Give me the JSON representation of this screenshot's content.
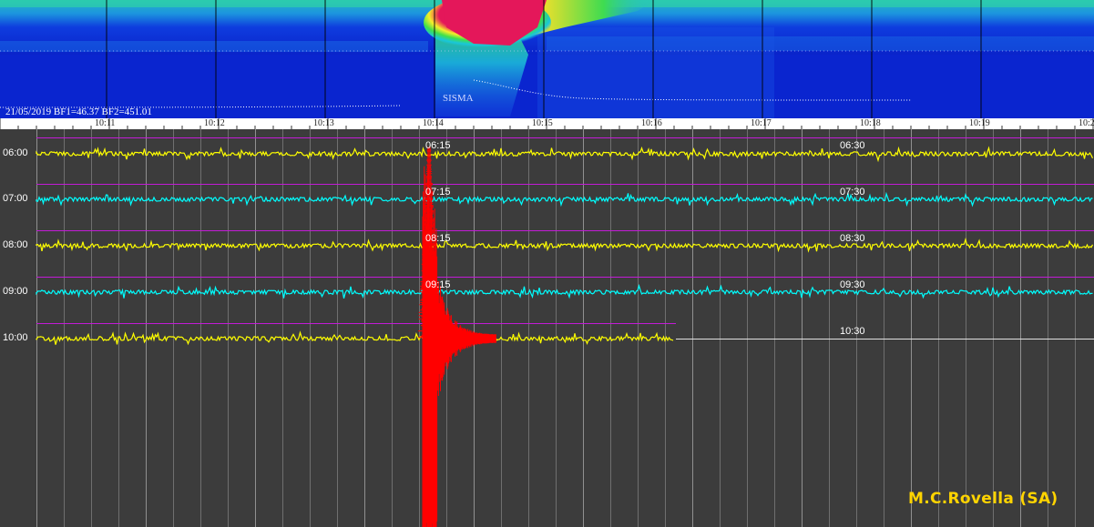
{
  "spectrogram": {
    "caption": "21/05/2019 BF1=46.37 BF2=451.01",
    "event_label": "SISMA",
    "colors": {
      "background": "#0b2bd6",
      "low": "#0e3fe8",
      "mid": "#17c9d8",
      "green": "#3ee34a",
      "yellow": "#f7f02a",
      "high": "#e01a55"
    }
  },
  "time_scale": {
    "labels": [
      "10:11",
      "10:12",
      "10:13",
      "10:14",
      "10:15",
      "10:16",
      "10:17",
      "10:18",
      "10:19",
      "10:2"
    ]
  },
  "seismogram": {
    "row_labels": [
      "06:00",
      "07:00",
      "08:00",
      "09:00",
      "10:00"
    ],
    "marker_labels_left": [
      "06:15",
      "07:15",
      "08:15",
      "09:15"
    ],
    "marker_labels_right": [
      "06:30",
      "07:30",
      "08:30",
      "09:30",
      "10:30"
    ],
    "trace_colors": [
      "#ffff00",
      "#00ffff",
      "#ffff00",
      "#00ffff",
      "#ffff00"
    ],
    "event_color": "#ff0000",
    "grid_color": "#9a9a9a",
    "separator_color": "#c21bd6"
  },
  "credit": "M.C.Rovella (SA)"
}
